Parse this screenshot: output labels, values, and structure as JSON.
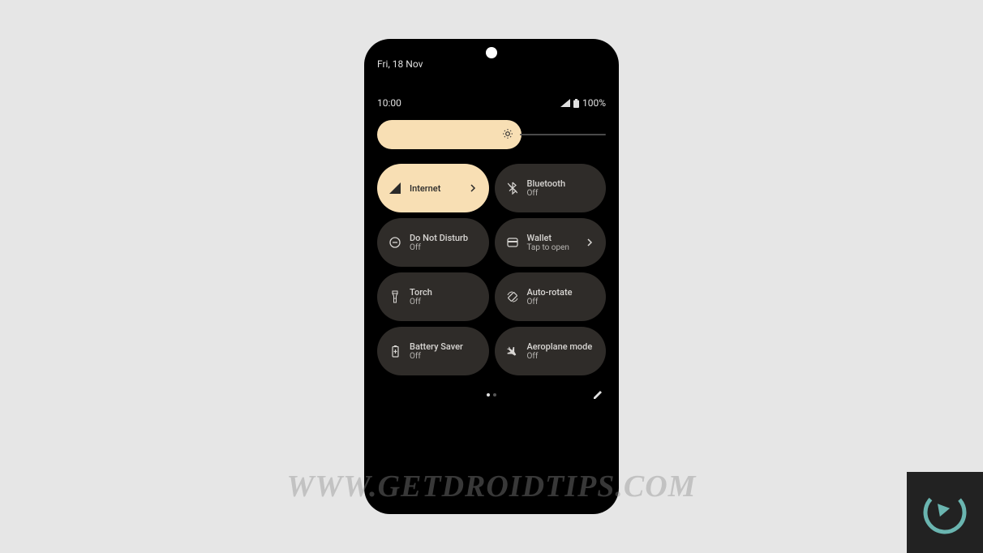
{
  "date": "Fri, 18 Nov",
  "time": "10:00",
  "battery": "100%",
  "brightness": {
    "percent": 62
  },
  "tiles": [
    {
      "title": "Internet",
      "sub": "",
      "active": true,
      "chevron": true
    },
    {
      "title": "Bluetooth",
      "sub": "Off",
      "active": false,
      "chevron": false
    },
    {
      "title": "Do Not Disturb",
      "sub": "Off",
      "active": false,
      "chevron": false
    },
    {
      "title": "Wallet",
      "sub": "Tap to open",
      "active": false,
      "chevron": true
    },
    {
      "title": "Torch",
      "sub": "Off",
      "active": false,
      "chevron": false
    },
    {
      "title": "Auto-rotate",
      "sub": "Off",
      "active": false,
      "chevron": false
    },
    {
      "title": "Battery Saver",
      "sub": "Off",
      "active": false,
      "chevron": false
    },
    {
      "title": "Aeroplane mode",
      "sub": "Off",
      "active": false,
      "chevron": false
    }
  ],
  "pagination": {
    "current": 0,
    "total": 2
  },
  "watermark": "WWW.GETDROIDTIPS.COM"
}
